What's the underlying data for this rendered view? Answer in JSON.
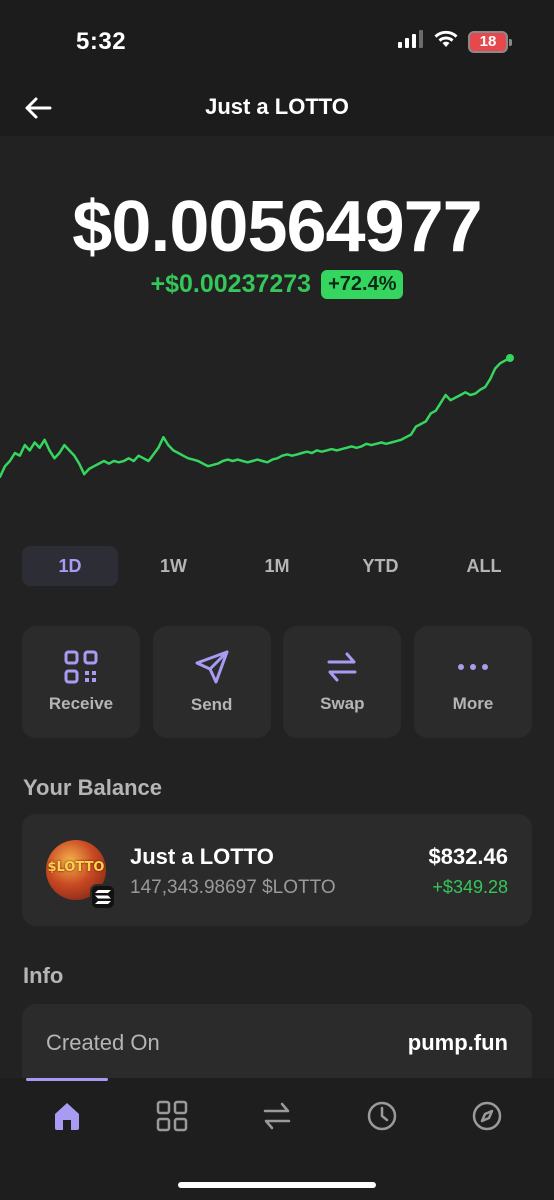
{
  "status": {
    "time": "5:32",
    "battery": "18"
  },
  "header": {
    "title": "Just a LOTTO"
  },
  "price": {
    "value": "$0.00564977",
    "change": "+$0.00237273",
    "change_pct": "+72.4%"
  },
  "colors": {
    "accent": "#a79cf2",
    "positive": "#34c759",
    "background": "#222222",
    "card": "#2b2b2b"
  },
  "chart_data": {
    "type": "line",
    "trend": [
      0.1,
      0.18,
      0.22,
      0.28,
      0.26,
      0.34,
      0.3,
      0.36,
      0.32,
      0.38,
      0.3,
      0.24,
      0.28,
      0.34,
      0.3,
      0.26,
      0.2,
      0.12,
      0.16,
      0.18,
      0.2,
      0.22,
      0.2,
      0.22,
      0.21,
      0.22,
      0.24,
      0.22,
      0.26,
      0.24,
      0.22,
      0.27,
      0.32,
      0.4,
      0.34,
      0.3,
      0.28,
      0.26,
      0.24,
      0.23,
      0.22,
      0.2,
      0.18,
      0.19,
      0.2,
      0.22,
      0.23,
      0.22,
      0.23,
      0.22,
      0.21,
      0.22,
      0.23,
      0.22,
      0.21,
      0.23,
      0.24,
      0.26,
      0.27,
      0.26,
      0.27,
      0.28,
      0.29,
      0.28,
      0.3,
      0.29,
      0.3,
      0.31,
      0.3,
      0.31,
      0.32,
      0.33,
      0.32,
      0.33,
      0.35,
      0.34,
      0.35,
      0.36,
      0.35,
      0.36,
      0.37,
      0.38,
      0.4,
      0.42,
      0.48,
      0.5,
      0.52,
      0.58,
      0.6,
      0.66,
      0.72,
      0.68,
      0.7,
      0.72,
      0.74,
      0.72,
      0.73,
      0.76,
      0.78,
      0.84,
      0.92,
      0.96,
      0.98,
      1.0
    ],
    "range": "1D",
    "line_color": "#34d660"
  },
  "range_tabs": [
    {
      "label": "1D",
      "active": true
    },
    {
      "label": "1W",
      "active": false
    },
    {
      "label": "1M",
      "active": false
    },
    {
      "label": "YTD",
      "active": false
    },
    {
      "label": "ALL",
      "active": false
    }
  ],
  "actions": [
    {
      "label": "Receive",
      "icon": "qr-code-icon"
    },
    {
      "label": "Send",
      "icon": "send-icon"
    },
    {
      "label": "Swap",
      "icon": "swap-icon"
    },
    {
      "label": "More",
      "icon": "more-icon"
    }
  ],
  "balance": {
    "title": "Your Balance",
    "token": {
      "name": "Just a LOTTO",
      "amount": "147,343.98697 $LOTTO",
      "value": "$832.46",
      "change": "+$349.28",
      "avatar_text": "$LOTTO",
      "chain_icon": "solana-icon"
    }
  },
  "info": {
    "title": "Info",
    "rows": [
      {
        "label": "Created On",
        "value": "pump.fun"
      }
    ]
  },
  "tab_bar": [
    {
      "name": "home",
      "icon": "home-icon",
      "active": true
    },
    {
      "name": "collectibles",
      "icon": "grid-icon",
      "active": false
    },
    {
      "name": "swap",
      "icon": "swap-icon",
      "active": false
    },
    {
      "name": "activity",
      "icon": "clock-icon",
      "active": false
    },
    {
      "name": "explore",
      "icon": "compass-icon",
      "active": false
    }
  ]
}
